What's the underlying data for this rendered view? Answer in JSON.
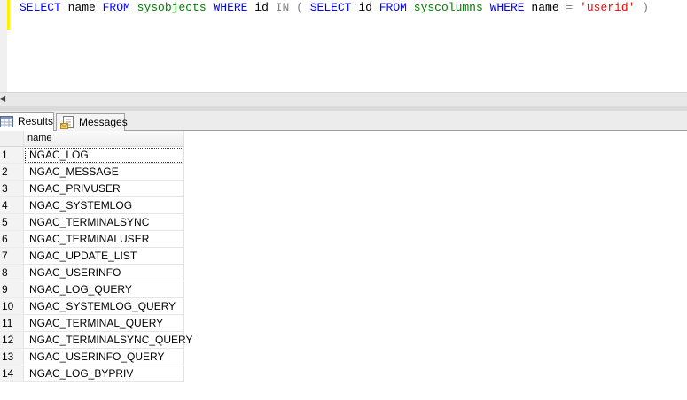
{
  "editor": {
    "query_tokens": [
      {
        "t": "SELECT",
        "c": "kw"
      },
      {
        "t": " name ",
        "c": "id"
      },
      {
        "t": "FROM",
        "c": "kw"
      },
      {
        "t": " sysobjects ",
        "c": "obj"
      },
      {
        "t": "WHERE",
        "c": "kw"
      },
      {
        "t": " id ",
        "c": "id"
      },
      {
        "t": "IN",
        "c": "op"
      },
      {
        "t": " ( ",
        "c": "op"
      },
      {
        "t": "SELECT",
        "c": "kw"
      },
      {
        "t": " id ",
        "c": "id"
      },
      {
        "t": "FROM",
        "c": "kw"
      },
      {
        "t": " syscolumns ",
        "c": "obj"
      },
      {
        "t": "WHERE",
        "c": "kw"
      },
      {
        "t": " name ",
        "c": "id"
      },
      {
        "t": "=",
        "c": "op"
      },
      {
        "t": " ",
        "c": "id"
      },
      {
        "t": "'userid'",
        "c": "str"
      },
      {
        "t": " )",
        "c": "op"
      }
    ]
  },
  "tabs": {
    "results_label": "Results",
    "messages_label": "Messages"
  },
  "grid": {
    "column_header": "name",
    "rows": [
      {
        "num": "1",
        "name": "NGAC_LOG"
      },
      {
        "num": "2",
        "name": "NGAC_MESSAGE"
      },
      {
        "num": "3",
        "name": "NGAC_PRIVUSER"
      },
      {
        "num": "4",
        "name": "NGAC_SYSTEMLOG"
      },
      {
        "num": "5",
        "name": "NGAC_TERMINALSYNC"
      },
      {
        "num": "6",
        "name": "NGAC_TERMINALUSER"
      },
      {
        "num": "7",
        "name": "NGAC_UPDATE_LIST"
      },
      {
        "num": "8",
        "name": "NGAC_USERINFO"
      },
      {
        "num": "9",
        "name": "NGAC_LOG_QUERY"
      },
      {
        "num": "10",
        "name": "NGAC_SYSTEMLOG_QUERY"
      },
      {
        "num": "11",
        "name": "NGAC_TERMINAL_QUERY"
      },
      {
        "num": "12",
        "name": "NGAC_TERMINALSYNC_QUERY"
      },
      {
        "num": "13",
        "name": "NGAC_USERINFO_QUERY"
      },
      {
        "num": "14",
        "name": "NGAC_LOG_BYPRIV"
      }
    ]
  },
  "colors": {
    "keyword": "#0000ff",
    "object": "#008000",
    "string": "#ff0000",
    "operator": "#808080",
    "change_bar": "#fff200"
  },
  "icons": {
    "results": "grid-icon",
    "messages": "messages-icon",
    "scroll_left": "scroll-left-arrow-icon"
  }
}
